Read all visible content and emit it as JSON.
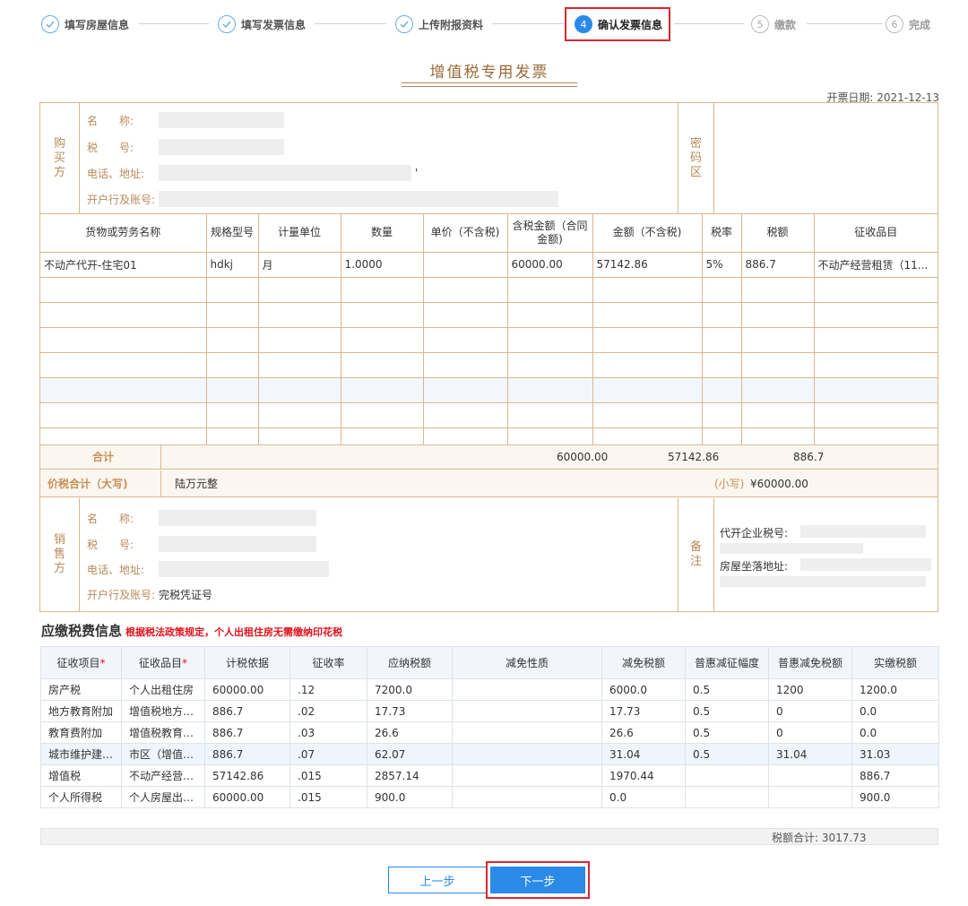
{
  "stepper": {
    "steps": [
      {
        "num": "1",
        "label": "填写房屋信息",
        "state": "done"
      },
      {
        "num": "2",
        "label": "填写发票信息",
        "state": "done"
      },
      {
        "num": "3",
        "label": "上传附报资料",
        "state": "done"
      },
      {
        "num": "4",
        "label": "确认发票信息",
        "state": "active"
      },
      {
        "num": "5",
        "label": "缴款",
        "state": "todo"
      },
      {
        "num": "6",
        "label": "完成",
        "state": "todo"
      }
    ]
  },
  "invoice": {
    "title": "增值税专用发票",
    "date_label": "开票日期:",
    "date": "2021-12-13",
    "buyer": {
      "side_label": "购买方",
      "name_label": "名　　称:",
      "taxid_label": "税　　号:",
      "addr_label": "电话、地址:",
      "bank_label": "开户行及账号:",
      "addr_tail": "'"
    },
    "password_area_label": "密码区",
    "goods_headers": [
      "货物或劳务名称",
      "规格型号",
      "计量单位",
      "数量",
      "单价（不含税)",
      "含税金额（合同金额)",
      "金额（不含税)",
      "税率",
      "税额",
      "征收品目"
    ],
    "goods_rows": [
      [
        "不动产代开-住宅01",
        "hdkj",
        "月",
        "1.0000",
        "",
        "60000.00",
        "57142.86",
        "5%",
        "886.7",
        "不动产经营租赁（11..."
      ]
    ],
    "total_label": "合计",
    "total_tax_incl": "60000.00",
    "total_amount": "57142.86",
    "total_tax": "886.7",
    "price_total_label": "价税合计（大写)",
    "price_total_upper": "陆万元整",
    "price_total_lower_label": "(小写)",
    "price_total_lower": "¥60000.00",
    "seller": {
      "side_label": "销售方",
      "name_label": "名　　称:",
      "taxid_label": "税　　号:",
      "addr_label": "电话、地址:",
      "bank_label": "开户行及账号:",
      "bank_value": "完税凭证号"
    },
    "remark_label": "备注",
    "remark": {
      "line1": "代开企业税号:",
      "line3": "房屋坐落地址:"
    }
  },
  "tax": {
    "title": "应缴税费信息",
    "notice": "根据税法政策规定，个人出租住房无需缴纳印花税",
    "headers": [
      {
        "label": "征收项目",
        "required": true
      },
      {
        "label": "征收品目",
        "required": true
      },
      {
        "label": "计税依据",
        "required": false
      },
      {
        "label": "征收率",
        "required": false
      },
      {
        "label": "应纳税额",
        "required": false
      },
      {
        "label": "减免性质",
        "required": false
      },
      {
        "label": "减免税额",
        "required": false
      },
      {
        "label": "普惠减征幅度",
        "required": false
      },
      {
        "label": "普惠减免税额",
        "required": false
      },
      {
        "label": "实缴税额",
        "required": false
      }
    ],
    "rows": [
      [
        "房产税",
        "个人出租住房",
        "60000.00",
        ".12",
        "7200.0",
        "",
        "6000.0",
        "0.5",
        "1200",
        "1200.0"
      ],
      [
        "地方教育附加",
        "增值税地方教...",
        "886.7",
        ".02",
        "17.73",
        "",
        "17.73",
        "0.5",
        "0",
        "0.0"
      ],
      [
        "教育费附加",
        "增值税教育费...",
        "886.7",
        ".03",
        "26.6",
        "",
        "26.6",
        "0.5",
        "0",
        "0.0"
      ],
      [
        "城市维护建设税",
        "市区（增值税...",
        "886.7",
        ".07",
        "62.07",
        "",
        "31.04",
        "0.5",
        "31.04",
        "31.03"
      ],
      [
        "增值税",
        "不动产经营租...",
        "57142.86",
        ".015",
        "2857.14",
        "",
        "1970.44",
        "",
        "",
        "886.7"
      ],
      [
        "个人所得税",
        "个人房屋出租...",
        "60000.00",
        ".015",
        "900.0",
        "",
        "0.0",
        "",
        "",
        "900.0"
      ]
    ],
    "total_text": "税额合计: 3017.73"
  },
  "buttons": {
    "prev": "上一步",
    "next": "下一步"
  },
  "colors": {
    "primary": "#2b8ae8",
    "invoice_border": "#d9b78e",
    "invoice_label": "#b88a5a",
    "highlight_red": "#d9262e",
    "notice_red": "#e0121c"
  }
}
